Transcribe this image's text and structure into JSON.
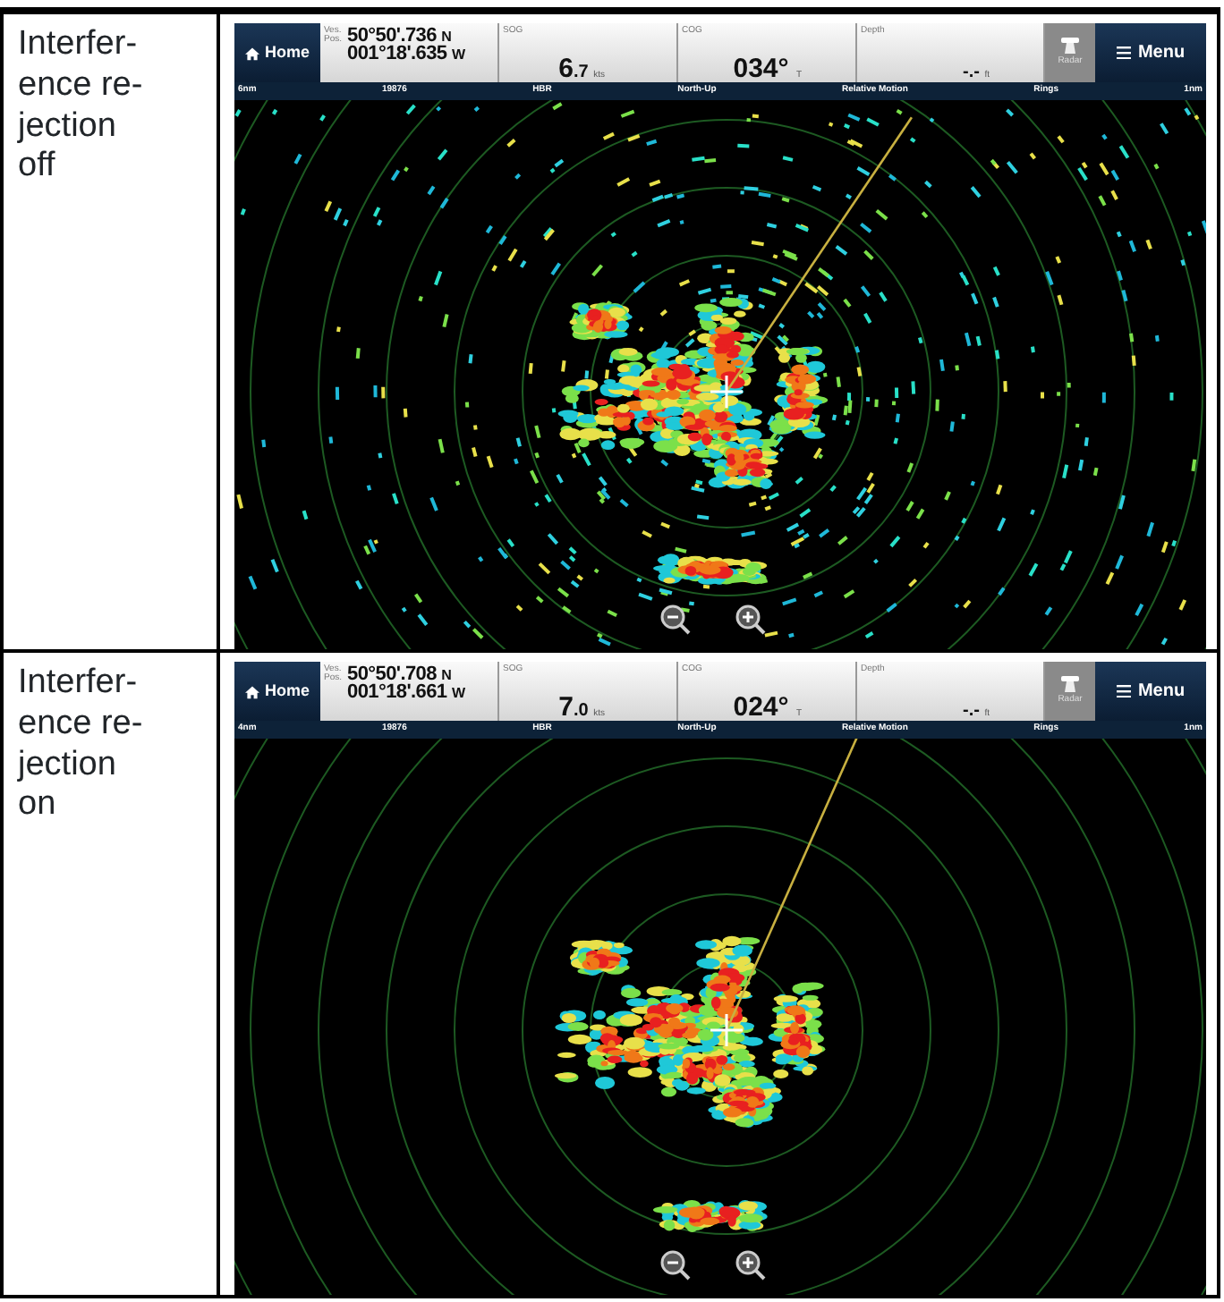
{
  "rows": [
    {
      "label": "Interfer-ence re-jection off",
      "screen": {
        "home": "Home",
        "pos_label": [
          "Ves.",
          "Pos."
        ],
        "lat": "50°50'.736",
        "lat_dir": "N",
        "lon": "001°18'.635",
        "lon_dir": "W",
        "sog_label": "SOG",
        "sog_int": "6",
        "sog_dec": ".7",
        "sog_unit": "kts",
        "cog_label": "COG",
        "cog": "034°",
        "cog_unit": "T",
        "depth_label": "Depth",
        "depth": "-.-",
        "depth_unit": "ft",
        "app": "Radar",
        "menu": "Menu",
        "status": [
          "6nm",
          "19876",
          "HBR",
          "North-Up",
          "Relative Motion",
          "Rings",
          "1nm"
        ],
        "interference_rejection": false
      }
    },
    {
      "label": "Interfer-ence re-jection on",
      "screen": {
        "home": "Home",
        "pos_label": [
          "Ves.",
          "Pos."
        ],
        "lat": "50°50'.708",
        "lat_dir": "N",
        "lon": "001°18'.661",
        "lon_dir": "W",
        "sog_label": "SOG",
        "sog_int": "7",
        "sog_dec": ".0",
        "sog_unit": "kts",
        "cog_label": "COG",
        "cog": "024°",
        "cog_unit": "T",
        "depth_label": "Depth",
        "depth": "-.-",
        "depth_unit": "ft",
        "app": "Radar",
        "menu": "Menu",
        "status": [
          "4nm",
          "19876",
          "HBR",
          "North-Up",
          "Relative Motion",
          "Rings",
          "1nm"
        ],
        "interference_rejection": true
      }
    }
  ]
}
